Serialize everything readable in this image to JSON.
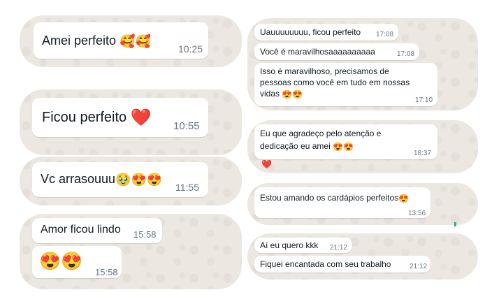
{
  "left": [
    {
      "text": "Amei perfeito",
      "emoji": "🥰🥰",
      "time": "10:25"
    },
    {
      "text": "Ficou perfeito",
      "emoji": "❤️",
      "time": "10:55"
    },
    {
      "text": "Vc arrasouuu",
      "emoji": "🥹😍😍",
      "time": "11:55"
    },
    {
      "lines": [
        {
          "text": "Amor ficou lindo",
          "time": "15:58"
        },
        {
          "emoji": "😍😍",
          "time": "15:58"
        }
      ]
    }
  ],
  "right": {
    "group1": [
      {
        "text": "Uauuuuuuuu, ficou perfeito",
        "time": "17:08"
      },
      {
        "text": "Você é maravilhosaaaaaaaaaa",
        "time": "17:08"
      },
      {
        "line1": "Isso é maravilhoso, precisamos de",
        "line2": "pessoas como você em tudo em nossas",
        "line3": "vidas",
        "emoji": "😍😍",
        "time": "17:10"
      }
    ],
    "group2": {
      "line1": "Eu que agradeço pelo atenção e",
      "line2": "dedicação eu amei",
      "emoji": "😍😍",
      "time": "18:37",
      "reaction": "❤️"
    },
    "group3": {
      "text": "Estou amando os cardápios perfeitos",
      "emoji": "😍",
      "time": "13:56"
    },
    "group4": [
      {
        "text": "Aí eu quero kkk",
        "time": "21:12"
      },
      {
        "text": "Fiquei encantada com seu trabalho",
        "time": "21:12"
      }
    ]
  }
}
